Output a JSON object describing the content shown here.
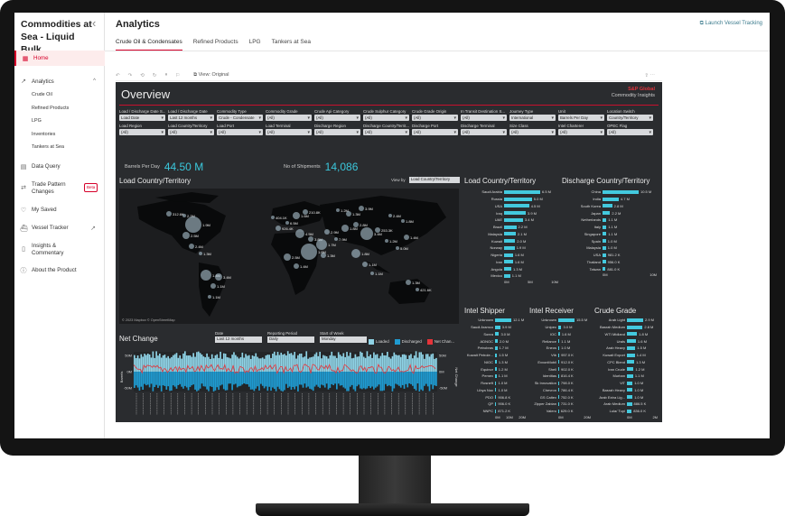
{
  "sidebar": {
    "title": "Commodities at Sea - Liquid Bulk",
    "items": {
      "home": "Home",
      "analytics": "Analytics",
      "data_query": "Data Query",
      "trade_pattern": "Trade Pattern Changes",
      "beta": "Beta",
      "my_saved": "My Saved",
      "vessel_tracker": "Vessel Tracker",
      "insights": "Insights & Commentary",
      "about": "About the Product"
    },
    "analytics_sub": [
      "Crude Oil",
      "Refined Products",
      "LPG",
      "Inventories",
      "Tankers at Sea"
    ]
  },
  "header": {
    "title": "Analytics",
    "launch": "Launch Vessel Tracking",
    "tabs": [
      "Crude Oil & Condensates",
      "Refined Products",
      "LPG",
      "Tankers at Sea"
    ]
  },
  "toolbar": {
    "view": "View: Original"
  },
  "dashboard": {
    "title": "Overview",
    "logo_line1": "S&P Global",
    "logo_line2": "Commodity Insights",
    "filters_row1": [
      {
        "label": "Load / Discharge Date S...",
        "value": "Load Date"
      },
      {
        "label": "Load / Discharge Date",
        "value": "Last 12 months"
      },
      {
        "label": "Commodity Type",
        "value": "Crude - Condensate"
      },
      {
        "label": "Commodity Grade",
        "value": "(All)"
      },
      {
        "label": "Crude Api Category",
        "value": "(All)"
      },
      {
        "label": "Crude Sulphur Category",
        "value": "(All)"
      },
      {
        "label": "Crude Grade Origin",
        "value": "(All)"
      },
      {
        "label": "In Transit Destination S...",
        "value": "(All)"
      },
      {
        "label": "Journey Type",
        "value": "International"
      },
      {
        "label": "Unit",
        "value": "Barrels Per Day"
      },
      {
        "label": "Location Switch",
        "value": "Country/Territory"
      }
    ],
    "filters_row2": [
      {
        "label": "Load Region",
        "value": "(All)"
      },
      {
        "label": "Load Country/Territory",
        "value": "(All)"
      },
      {
        "label": "Load Port",
        "value": "(All)"
      },
      {
        "label": "Load Terminal",
        "value": "(All)"
      },
      {
        "label": "Discharge Region",
        "value": "(All)"
      },
      {
        "label": "Discharge Country/Territ...",
        "value": "(All)"
      },
      {
        "label": "Discharge Port",
        "value": "(All)"
      },
      {
        "label": "Discharge Terminal",
        "value": "(All)"
      },
      {
        "label": "Size Class",
        "value": "(All)"
      },
      {
        "label": "Intel Charterer",
        "value": "(All)"
      },
      {
        "label": "OPEC Flag",
        "value": "(All)"
      }
    ],
    "kpi": {
      "bpd_label": "Barrels Per Day",
      "bpd_value": "44.50 M",
      "ships_label": "No of Shipments",
      "ships_value": "14,086"
    },
    "map_title": "Load Country/Territory",
    "view_by_label": "View by",
    "view_by_value": "Load Country/Territory",
    "map_credit": "© 2023 Mapbox © OpenStreetMap",
    "map_labels": [
      "312.6K",
      "2.2M",
      "1.9M",
      "2.5M",
      "2.4M",
      "1.3M",
      "1.4M",
      "1.1M",
      "1.1M",
      "3.4M",
      "404.1K",
      "926.4K",
      "6.5M",
      "1.6M",
      "210.8K",
      "4.5M",
      "3.8M",
      "1.7M",
      "1.6M",
      "1.4M",
      "2.5M",
      "2.9M",
      "7.9M",
      "1.8M",
      "2.8M",
      "3.4M",
      "253.3K",
      "1.2M",
      "5.0M",
      "1.4M",
      "1.8M",
      "1.1M",
      "1.1M",
      "1.3M",
      "421.6K",
      "1.2M",
      "1.3M",
      "3.9M",
      "2.4M",
      "1.8M",
      "1.3M"
    ],
    "load_bars": {
      "title": "Load Country/Territory",
      "axis": [
        "0M",
        "5M",
        "10M"
      ],
      "rows": [
        {
          "label": "Saudi Arabia",
          "value": "6.5 M",
          "v": 6.5
        },
        {
          "label": "Russia",
          "value": "5.0 M",
          "v": 5.0
        },
        {
          "label": "USA",
          "value": "4.5 M",
          "v": 4.5
        },
        {
          "label": "Iraq",
          "value": "3.9 M",
          "v": 3.9
        },
        {
          "label": "UAE",
          "value": "3.4 M",
          "v": 3.4
        },
        {
          "label": "Brazil",
          "value": "2.2 M",
          "v": 2.2
        },
        {
          "label": "Malaysia",
          "value": "2.1 M",
          "v": 2.1
        },
        {
          "label": "Kuwait",
          "value": "2.0 M",
          "v": 2.0
        },
        {
          "label": "Norway",
          "value": "1.9 M",
          "v": 1.9
        },
        {
          "label": "Nigeria",
          "value": "1.6 M",
          "v": 1.6
        },
        {
          "label": "Iran",
          "value": "1.6 M",
          "v": 1.6
        },
        {
          "label": "Angola",
          "value": "1.3 M",
          "v": 1.3
        },
        {
          "label": "Mexico",
          "value": "1.1 M",
          "v": 1.1
        }
      ]
    },
    "disch_bars": {
      "title": "Discharge Country/Territory",
      "axis": [
        "0M",
        "10M"
      ],
      "rows": [
        {
          "label": "China",
          "value": "10.5 M",
          "v": 10.5
        },
        {
          "label": "India",
          "value": "4.7 M",
          "v": 4.7
        },
        {
          "label": "South Korea",
          "value": "2.8 M",
          "v": 2.8
        },
        {
          "label": "Japan",
          "value": "2.2 M",
          "v": 2.2
        },
        {
          "label": "Netherlands",
          "value": "1.1 M",
          "v": 1.1
        },
        {
          "label": "Italy",
          "value": "1.1 M",
          "v": 1.1
        },
        {
          "label": "Singapore",
          "value": "1.1 M",
          "v": 1.1
        },
        {
          "label": "Spain",
          "value": "1.0 M",
          "v": 1.0
        },
        {
          "label": "Malaysia",
          "value": "1.0 M",
          "v": 1.0
        },
        {
          "label": "USA",
          "value": "981.2 K",
          "v": 0.98
        },
        {
          "label": "Thailand",
          "value": "956.0 K",
          "v": 0.95
        },
        {
          "label": "Taiwan",
          "value": "881.0 K",
          "v": 0.88
        }
      ]
    },
    "shipper": {
      "title": "Intel Shipper",
      "axis": [
        "0M",
        "10M",
        "20M"
      ],
      "rows": [
        {
          "label": "Unknown",
          "value": "12.1 M",
          "v": 12.1
        },
        {
          "label": "Saudi Aramco",
          "value": "3.9 M",
          "v": 3.9
        },
        {
          "label": "Sonra",
          "value": "3.0 M",
          "v": 3.0
        },
        {
          "label": "ADNOC",
          "value": "2.0 M",
          "v": 2.0
        },
        {
          "label": "Petrobras",
          "value": "1.7 M",
          "v": 1.7
        },
        {
          "label": "Kuwait Petrole...",
          "value": "1.5 M",
          "v": 1.5
        },
        {
          "label": "NIOC",
          "value": "1.3 M",
          "v": 1.3
        },
        {
          "label": "Equinor",
          "value": "1.2 M",
          "v": 1.2
        },
        {
          "label": "Pemex",
          "value": "1.1 M",
          "v": 1.1
        },
        {
          "label": "Rosneft",
          "value": "1.0 M",
          "v": 1.0
        },
        {
          "label": "Libya Noc",
          "value": "1.0 M",
          "v": 1.0
        },
        {
          "label": "PDO",
          "value": "906.8 K",
          "v": 0.91
        },
        {
          "label": "QP",
          "value": "906.0 K",
          "v": 0.91
        },
        {
          "label": "NNPC",
          "value": "871.2 K",
          "v": 0.87
        }
      ]
    },
    "receiver": {
      "title": "Intel Receiver",
      "axis": [
        "0M",
        "20M"
      ],
      "rows": [
        {
          "label": "Unknown",
          "value": "15.5 M",
          "v": 15.5
        },
        {
          "label": "Unipec",
          "value": "3.0 M",
          "v": 3.0
        },
        {
          "label": "IOC",
          "value": "1.6 M",
          "v": 1.6
        },
        {
          "label": "Reliance",
          "value": "1.1 M",
          "v": 1.1
        },
        {
          "label": "Eneos",
          "value": "1.0 M",
          "v": 1.0
        },
        {
          "label": "Vtb",
          "value": "957.0 K",
          "v": 0.96
        },
        {
          "label": "ExxonMobil",
          "value": "912.0 K",
          "v": 0.91
        },
        {
          "label": "Shell",
          "value": "902.0 K",
          "v": 0.9
        },
        {
          "label": "Identitas",
          "value": "816.4 K",
          "v": 0.82
        },
        {
          "label": "Sk Innovation",
          "value": "798.0 K",
          "v": 0.8
        },
        {
          "label": "Chevron",
          "value": "786.4 K",
          "v": 0.79
        },
        {
          "label": "GS Caltex",
          "value": "752.0 K",
          "v": 0.75
        },
        {
          "label": "Zipper Zabian",
          "value": "731.0 K",
          "v": 0.73
        },
        {
          "label": "Valero",
          "value": "629.0 K",
          "v": 0.63
        }
      ]
    },
    "grade": {
      "title": "Crude Grade",
      "axis": [
        "0M",
        "2M"
      ],
      "rows": [
        {
          "label": "Arab Light",
          "value": "2.9 M",
          "v": 2.9
        },
        {
          "label": "Basrah Medium",
          "value": "2.8 M",
          "v": 2.8
        },
        {
          "label": "WTI Midland",
          "value": "1.8 M",
          "v": 1.8
        },
        {
          "label": "Urals",
          "value": "1.6 M",
          "v": 1.6
        },
        {
          "label": "Arab Heavy",
          "value": "1.5 M",
          "v": 1.5
        },
        {
          "label": "Kuwait Export",
          "value": "1.4 M",
          "v": 1.4
        },
        {
          "label": "CPC Blend",
          "value": "1.3 M",
          "v": 1.3
        },
        {
          "label": "Iran Crude",
          "value": "1.2 M",
          "v": 1.2
        },
        {
          "label": "Murban",
          "value": "1.1 M",
          "v": 1.1
        },
        {
          "label": "ViT",
          "value": "1.0 M",
          "v": 1.0
        },
        {
          "label": "Basrah Heavy",
          "value": "1.0 M",
          "v": 1.0
        },
        {
          "label": "Arab Extra Lig...",
          "value": "1.0 M",
          "v": 1.0
        },
        {
          "label": "Arab Medium",
          "value": "886.5 K",
          "v": 0.89
        },
        {
          "label": "Lula/ Tupi",
          "value": "836.0 K",
          "v": 0.84
        }
      ]
    },
    "netchange": {
      "title": "Net Change",
      "date_label": "Date",
      "date_value": "Last 12 months",
      "period_label": "Reporting Period",
      "period_value": "Daily",
      "week_label": "Start of Week",
      "week_value": "Monday",
      "legend": [
        "Loaded",
        "Discharged",
        "Net Chan..."
      ],
      "yleft": [
        "50M",
        "0M",
        "-50M"
      ],
      "yright": [
        "50M",
        "0M",
        "-50M"
      ],
      "ylabel_left": "Barrels",
      "ylabel_right": "Net Change"
    }
  },
  "chart_data": {
    "type": "bar",
    "title": "Load Country/Territory",
    "categories": [
      "Saudi Arabia",
      "Russia",
      "USA",
      "Iraq",
      "UAE",
      "Brazil",
      "Malaysia",
      "Kuwait",
      "Norway",
      "Nigeria",
      "Iran",
      "Angola",
      "Mexico"
    ],
    "values": [
      6.5,
      5.0,
      4.5,
      3.9,
      3.4,
      2.2,
      2.1,
      2.0,
      1.9,
      1.6,
      1.6,
      1.3,
      1.1
    ]
  },
  "colors": {
    "accent": "#d6002a",
    "bar": "#43c9de",
    "loaded": "#8fd3e6",
    "discharged": "#1f9bd1",
    "net": "#e5343a"
  }
}
